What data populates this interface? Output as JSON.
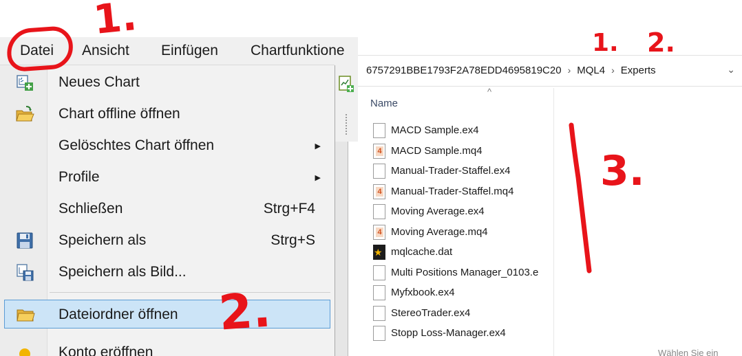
{
  "menubar": {
    "items": [
      "Datei",
      "Ansicht",
      "Einfügen",
      "Chartfunktione"
    ]
  },
  "file_menu": {
    "items": [
      {
        "label": "Neues Chart",
        "shortcut": "",
        "submenu": false,
        "icon": "new-chart-icon"
      },
      {
        "label": "Chart offline öffnen",
        "shortcut": "",
        "submenu": false,
        "icon": "open-folder-icon"
      },
      {
        "label": "Gelöschtes Chart öffnen",
        "shortcut": "",
        "submenu": true,
        "icon": ""
      },
      {
        "label": "Profile",
        "shortcut": "",
        "submenu": true,
        "icon": ""
      },
      {
        "label": "Schließen",
        "shortcut": "Strg+F4",
        "submenu": false,
        "icon": ""
      },
      {
        "label": "Speichern als",
        "shortcut": "Strg+S",
        "submenu": false,
        "icon": "floppy-disk-icon"
      },
      {
        "label": "Speichern als Bild...",
        "shortcut": "",
        "submenu": false,
        "icon": "save-image-icon"
      },
      {
        "label": "Dateiordner öffnen",
        "shortcut": "",
        "submenu": false,
        "icon": "folder-icon",
        "highlighted": true
      },
      {
        "label": "Konto eröffnen",
        "shortcut": "",
        "submenu": false,
        "icon": "account-icon"
      }
    ]
  },
  "explorer": {
    "breadcrumb": [
      "6757291BBE1793F2A78EDD4695819C20",
      "MQL4",
      "Experts"
    ],
    "column_header": "Name",
    "files": [
      {
        "name": "MACD Sample.ex4",
        "type": "ex4"
      },
      {
        "name": "MACD Sample.mq4",
        "type": "mq4"
      },
      {
        "name": "Manual-Trader-Staffel.ex4",
        "type": "ex4"
      },
      {
        "name": "Manual-Trader-Staffel.mq4",
        "type": "mq4"
      },
      {
        "name": "Moving Average.ex4",
        "type": "ex4"
      },
      {
        "name": "Moving Average.mq4",
        "type": "mq4"
      },
      {
        "name": "mqlcache.dat",
        "type": "dat"
      },
      {
        "name": "Multi Positions Manager_0103.e",
        "type": "ex4"
      },
      {
        "name": "Myfxbook.ex4",
        "type": "ex4"
      },
      {
        "name": "StereoTrader.ex4",
        "type": "ex4"
      },
      {
        "name": "Stopp Loss-Manager.ex4",
        "type": "ex4"
      }
    ],
    "bottom_hint": "Wählen Sie ein"
  },
  "annotations": {
    "left_1": "1.",
    "left_2": "2.",
    "right_1": "1.",
    "right_2": "2.",
    "right_3": "3."
  },
  "colors": {
    "annotation_red": "#e8141a",
    "highlight_fill": "#cce4f7",
    "highlight_border": "#5a9bd5",
    "menu_bg": "#f2f2f2"
  }
}
